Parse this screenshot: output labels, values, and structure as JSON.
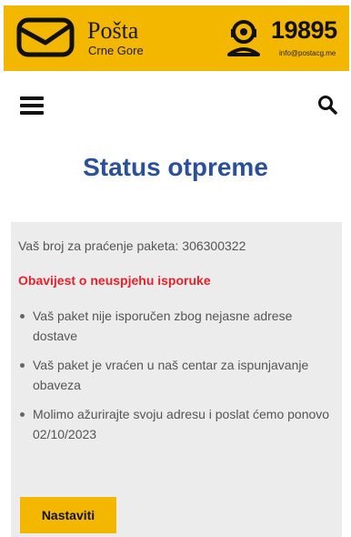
{
  "header": {
    "brand_name": "Pošta",
    "brand_sub": "Crne Gore",
    "phone": "19895",
    "email": "info@postacg.me",
    "logo_icon": "envelope-icon",
    "support_icon": "headset-icon",
    "color": "#f4b700"
  },
  "nav": {
    "menu_icon": "hamburger-menu-icon",
    "search_icon": "search-icon"
  },
  "page": {
    "title": "Status otpreme",
    "title_color": "#2a5099"
  },
  "card": {
    "tracking_text": "Vaš broj za praćenje paketa: 306300322",
    "notice": "Obavijest o neuspjehu isporuke",
    "notice_color": "#e8202a",
    "bullets": [
      "Vaš paket nije isporučen zbog nejasne adrese dostave",
      "Vaš paket je vraćen u naš centar za ispunjavanje obaveza",
      "Molimo ažurirajte svoju adresu i poslat ćemo ponovo 02/10/2023"
    ],
    "button_label": "Nastaviti"
  }
}
